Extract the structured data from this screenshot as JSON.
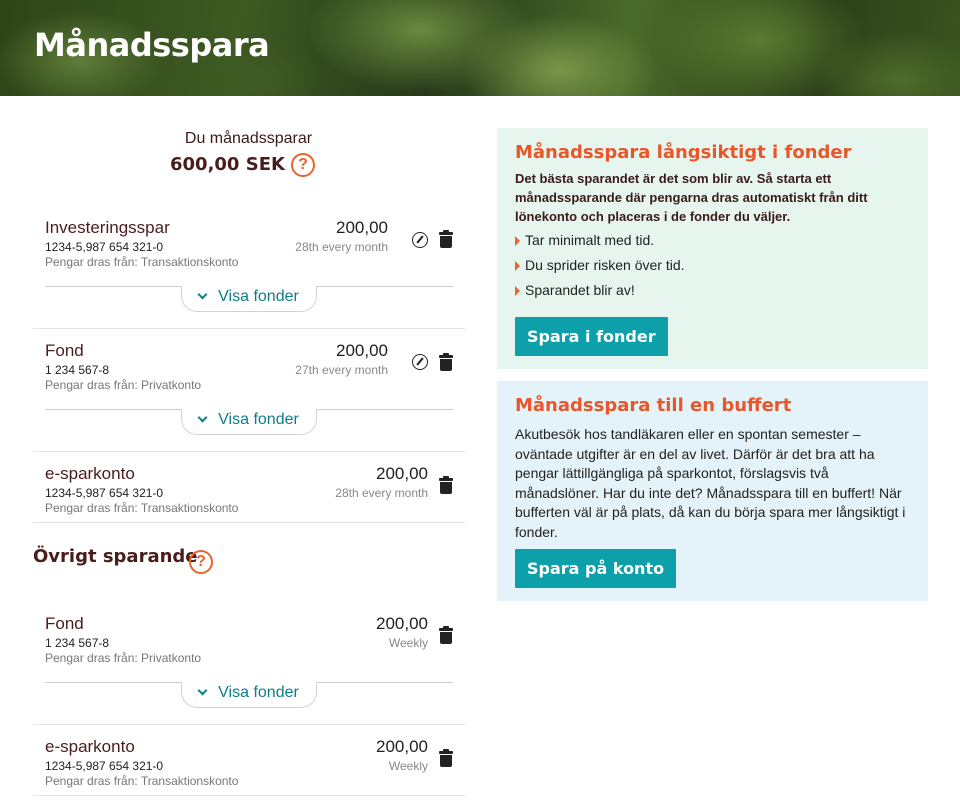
{
  "header": {
    "title": "Månadsspara"
  },
  "summary": {
    "label": "Du månadssparar",
    "total": "600,00 SEK",
    "help": "?"
  },
  "monthly_items": [
    {
      "name": "Investeringsspar",
      "account": "1234-5,987 654 321-0",
      "from": "Pengar dras från: Transaktionskonto",
      "amount": "200,00",
      "frequency": "28th every month",
      "show_funds": "Visa fonder"
    },
    {
      "name": "Fond",
      "account": "1 234 567-8",
      "from": "Pengar dras från: Privatkonto",
      "amount": "200,00",
      "frequency": "27th every month",
      "show_funds": "Visa fonder"
    },
    {
      "name": "e-sparkonto",
      "account": "1234-5,987 654 321-0",
      "from": "Pengar dras från: Transaktionskonto",
      "amount": "200,00",
      "frequency": "28th every month"
    }
  ],
  "other_savings": {
    "title": "Övrigt sparande",
    "help": "?",
    "items": [
      {
        "name": "Fond",
        "account": "1 234 567-8",
        "from": "Pengar dras från: Privatkonto",
        "amount": "200,00",
        "frequency": "Weekly",
        "show_funds": "Visa fonder"
      },
      {
        "name": "e-sparkonto",
        "account": "1234-5,987 654 321-0",
        "from": "Pengar dras från: Transaktionskonto",
        "amount": "200,00",
        "frequency": "Weekly"
      }
    ]
  },
  "promo_funds": {
    "heading": "Månadsspara långsiktigt i fonder",
    "lead": "Det bästa sparandet är det som blir av. Så starta ett månadssparande där pengarna dras automatiskt från ditt lönekonto och placeras i de fonder du väljer.",
    "bullets": [
      "Tar minimalt med tid.",
      "Du sprider risken över tid.",
      "Sparandet blir av!"
    ],
    "button": "Spara i fonder"
  },
  "promo_buffer": {
    "heading": "Månadsspara till en buffert",
    "body": "Akutbesök hos tandläkaren eller en spontan semester – oväntade utgifter är en del av livet. Därför är det bra att ha pengar lättillgängliga på sparkontot, förslagsvis två månadslöner. Har du inte det? Månadsspara till en buffert! När bufferten väl är på plats, då kan du börja spara mer långsiktigt i fonder.",
    "button": "Spara på konto"
  },
  "colors": {
    "accent_orange": "#e8562a",
    "teal": "#0ea0aa",
    "brown": "#4a1d1d",
    "green_card": "#e6f6ee",
    "blue_card": "#e4f3f9"
  }
}
